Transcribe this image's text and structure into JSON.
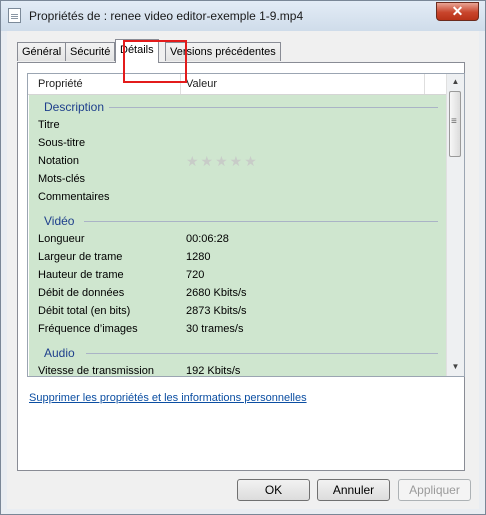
{
  "window": {
    "title": "Propriétés de : renee video editor-exemple 1-9.mp4",
    "close_label": "✕"
  },
  "tabs": [
    {
      "label": "Général",
      "active": false
    },
    {
      "label": "Sécurité",
      "active": false
    },
    {
      "label": "Détails",
      "active": true
    },
    {
      "label": "Versions précédentes",
      "active": false
    }
  ],
  "table": {
    "headers": {
      "property": "Propriété",
      "value": "Valeur"
    },
    "groups": {
      "description": "Description",
      "video": "Vidéo",
      "audio": "Audio"
    },
    "description_rows": [
      {
        "key": "Titre",
        "value": ""
      },
      {
        "key": "Sous-titre",
        "value": ""
      },
      {
        "key": "Notation",
        "value": ""
      },
      {
        "key": "Mots-clés",
        "value": ""
      },
      {
        "key": "Commentaires",
        "value": ""
      }
    ],
    "rating_stars": "★★★★★",
    "video_rows": [
      {
        "key": "Longueur",
        "value": "00:06:28"
      },
      {
        "key": "Largeur de trame",
        "value": "1280"
      },
      {
        "key": "Hauteur de trame",
        "value": "720"
      },
      {
        "key": "Débit de données",
        "value": "2680 Kbits/s"
      },
      {
        "key": "Débit total (en bits)",
        "value": "2873 Kbits/s"
      },
      {
        "key": "Fréquence d’images",
        "value": "30 trames/s"
      }
    ],
    "audio_rows": [
      {
        "key": "Vitesse de transmission",
        "value": "192 Kbits/s"
      }
    ]
  },
  "link": "Supprimer les propriétés et les informations personnelles",
  "buttons": {
    "ok": "OK",
    "cancel": "Annuler",
    "apply": "Appliquer"
  },
  "colors": {
    "highlight": "#e31b1b",
    "list_bg": "#cfe6cf",
    "group_text": "#1e3f8c",
    "link": "#0b4ea2"
  }
}
